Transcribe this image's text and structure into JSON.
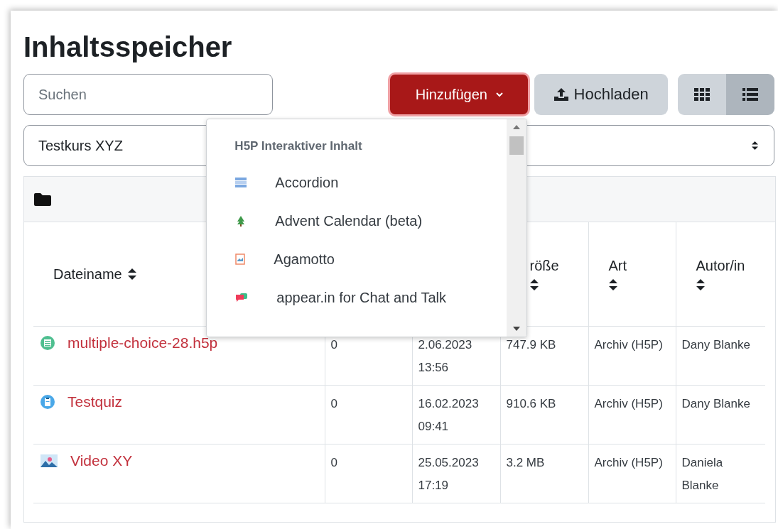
{
  "title": "Inhaltsspeicher",
  "search": {
    "placeholder": "Suchen"
  },
  "add_button": {
    "label": "Hinzufügen"
  },
  "upload_button": {
    "label": "Hochladen"
  },
  "view_toggle": [
    {
      "kind": "grid",
      "selected": false
    },
    {
      "kind": "list",
      "selected": true
    }
  ],
  "context_select": {
    "value": "Testkurs XYZ"
  },
  "add_menu": {
    "heading": "H5P Interaktiver Inhalt",
    "items": [
      {
        "label": "Accordion",
        "kind": "accordion"
      },
      {
        "label": "Advent Calendar (beta)",
        "kind": "tree"
      },
      {
        "label": "Agamotto",
        "kind": "image"
      },
      {
        "label": "appear.in for Chat and Talk",
        "kind": "chat"
      }
    ]
  },
  "table": {
    "columns": [
      {
        "label": "Dateiname",
        "sortable": true
      },
      {},
      {},
      {
        "label": "röße",
        "sortable": true
      },
      {
        "label": "Art",
        "sortable": true
      },
      {
        "label": "Autor/in",
        "sortable": true
      }
    ],
    "rows": [
      {
        "kind": "list",
        "cells": [
          "multiple-choice-28.h5p",
          "0",
          "2.06.2023 13:56",
          "747.9 KB",
          "Archiv (H5P)",
          "Dany Blanke"
        ]
      },
      {
        "kind": "quiz",
        "cells": [
          "Testquiz",
          "0",
          "16.02.2023 09:41",
          "910.6 KB",
          "Archiv (H5P)",
          "Dany Blanke"
        ]
      },
      {
        "kind": "video",
        "cells": [
          "Video XY",
          "0",
          "25.05.2023 17:19",
          "3.2 MB",
          "Archiv (H5P)",
          "Daniela Blanke"
        ]
      }
    ]
  }
}
